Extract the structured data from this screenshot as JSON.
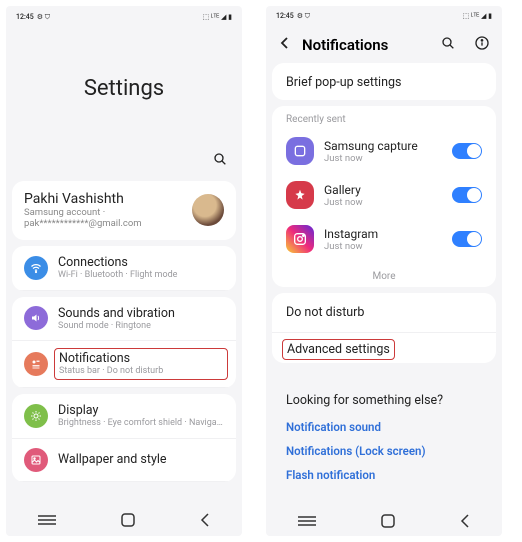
{
  "statusbar": {
    "time": "12:45",
    "badges": "⚙ ⛉",
    "right": "⬚ ᴸᵀᴱ ◢ ▮"
  },
  "screen1": {
    "title": "Settings",
    "account": {
      "name": "Pakhi Vashishth",
      "sub": "Samsung account · pak************@gmail.com"
    },
    "items": [
      {
        "title": "Connections",
        "sub": "Wi-Fi · Bluetooth · Flight mode",
        "color": "#3b8de6",
        "icon": "wifi"
      },
      {
        "title": "Sounds and vibration",
        "sub": "Sound mode · Ringtone",
        "color": "#8d6bd9",
        "icon": "sound"
      },
      {
        "title": "Notifications",
        "sub": "Status bar · Do not disturb",
        "color": "#e67a5c",
        "icon": "notif",
        "highlight": true
      },
      {
        "title": "Display",
        "sub": "Brightness · Eye comfort shield · Navigation bar",
        "color": "#7fbf4a",
        "icon": "display"
      },
      {
        "title": "Wallpaper and style",
        "sub": "",
        "color": "#e05a7a",
        "icon": "wallpaper"
      }
    ]
  },
  "screen2": {
    "title": "Notifications",
    "brief": "Brief pop-up settings",
    "recent_header": "Recently sent",
    "apps": [
      {
        "name": "Samsung capture",
        "sub": "Just now",
        "color": "#7a6fe0"
      },
      {
        "name": "Gallery",
        "sub": "Just now",
        "color": "#d63a4a"
      },
      {
        "name": "Instagram",
        "sub": "Just now",
        "gradient": true
      }
    ],
    "more": "More",
    "dnd": "Do not disturb",
    "advanced": "Advanced settings",
    "looking": {
      "title": "Looking for something else?",
      "links": [
        "Notification sound",
        "Notifications (Lock screen)",
        "Flash notification"
      ]
    }
  }
}
